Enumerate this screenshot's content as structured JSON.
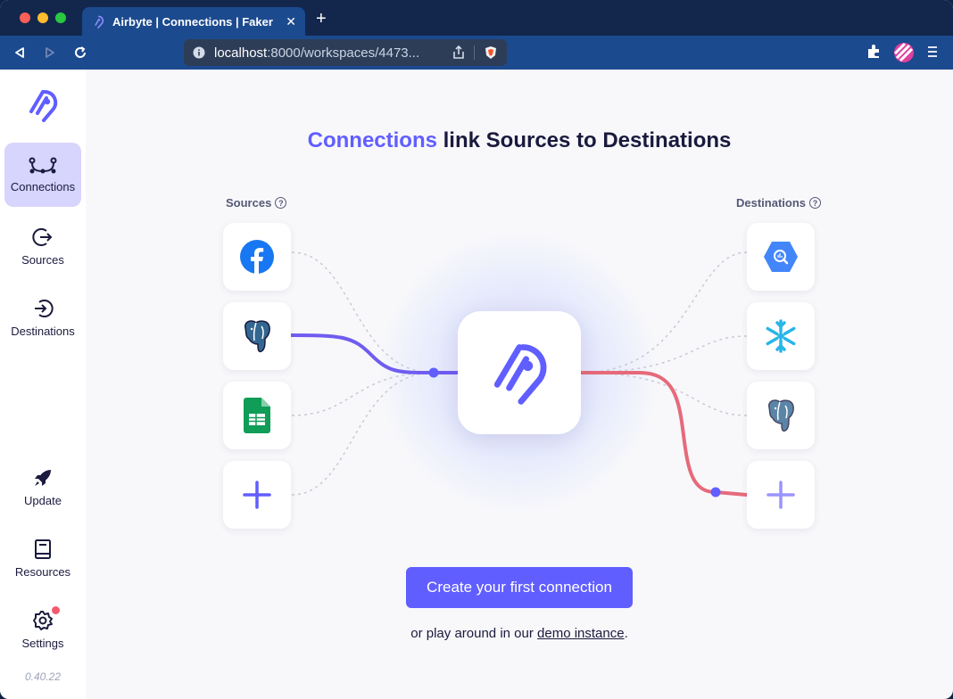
{
  "browser": {
    "tab_title": "Airbyte | Connections | Faker →",
    "tab_close": "✕",
    "new_tab": "+",
    "url_host": "localhost",
    "url_rest": ":8000/workspaces/4473..."
  },
  "sidebar": {
    "items": [
      {
        "label": "Connections",
        "icon": "connections-icon",
        "active": true
      },
      {
        "label": "Sources",
        "icon": "sources-icon"
      },
      {
        "label": "Destinations",
        "icon": "destinations-icon"
      }
    ],
    "bottom": [
      {
        "label": "Update",
        "icon": "rocket-icon"
      },
      {
        "label": "Resources",
        "icon": "book-icon"
      },
      {
        "label": "Settings",
        "icon": "gear-icon",
        "badge": true
      }
    ],
    "version": "0.40.22"
  },
  "main": {
    "headline_accent": "Connections",
    "headline_rest": " link Sources to Destinations",
    "sources_label": "Sources",
    "destinations_label": "Destinations",
    "help_glyph": "?",
    "sources": [
      "facebook-icon",
      "postgres-icon",
      "google-sheets-icon",
      "add-icon"
    ],
    "destinations": [
      "bigquery-icon",
      "snowflake-icon",
      "postgres-icon",
      "add-icon"
    ],
    "cta_label": "Create your first connection",
    "sub_prefix": "or play around in our ",
    "sub_link": "demo instance",
    "sub_suffix": "."
  },
  "colors": {
    "accent": "#615eff",
    "destination_line": "#e66a7a",
    "nav_active_bg": "#d7d4fd"
  }
}
